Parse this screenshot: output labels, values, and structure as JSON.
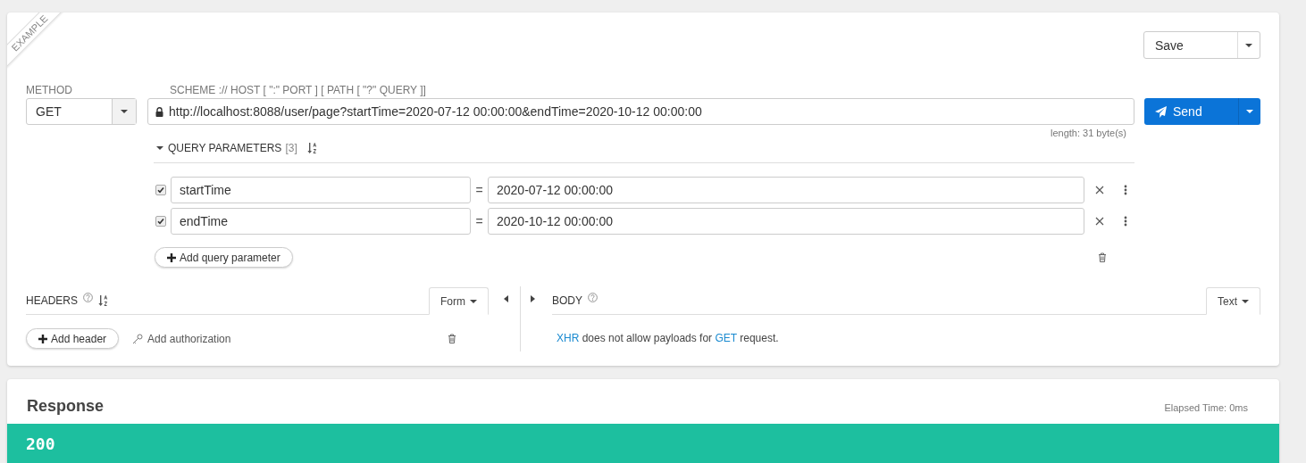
{
  "ribbon": {
    "label": "EXAMPLE"
  },
  "save": {
    "label": "Save"
  },
  "method": {
    "label": "METHOD",
    "value": "GET"
  },
  "url": {
    "label": "SCHEME :// HOST [ \":\" PORT ] [ PATH [ \"?\" QUERY ]]",
    "value": "http://localhost:8088/user/page?startTime=2020-07-12 00:00:00&endTime=2020-10-12 00:00:00",
    "length": "length: 31 byte(s)"
  },
  "send": {
    "label": "Send"
  },
  "query": {
    "title": "QUERY PARAMETERS",
    "count": "[3]",
    "expanded": true,
    "params": [
      {
        "checked": true,
        "name": "startTime",
        "separator": "=",
        "value": "2020-07-12 00:00:00"
      },
      {
        "checked": true,
        "name": "endTime",
        "separator": "=",
        "value": "2020-10-12 00:00:00"
      }
    ],
    "add_label": "Add query parameter"
  },
  "headers": {
    "title": "HEADERS",
    "mode": "Form",
    "add_header": "Add header",
    "add_authorization": "Add authorization"
  },
  "body": {
    "title": "BODY",
    "mode": "Text",
    "message": [
      {
        "kind": "link",
        "text": "XHR"
      },
      {
        "kind": "text",
        "text": " does not allow payloads for "
      },
      {
        "kind": "link",
        "text": "GET"
      },
      {
        "kind": "text",
        "text": " request."
      }
    ]
  },
  "response": {
    "title": "Response",
    "elapsed": "Elapsed Time: 0ms",
    "status": "200"
  }
}
